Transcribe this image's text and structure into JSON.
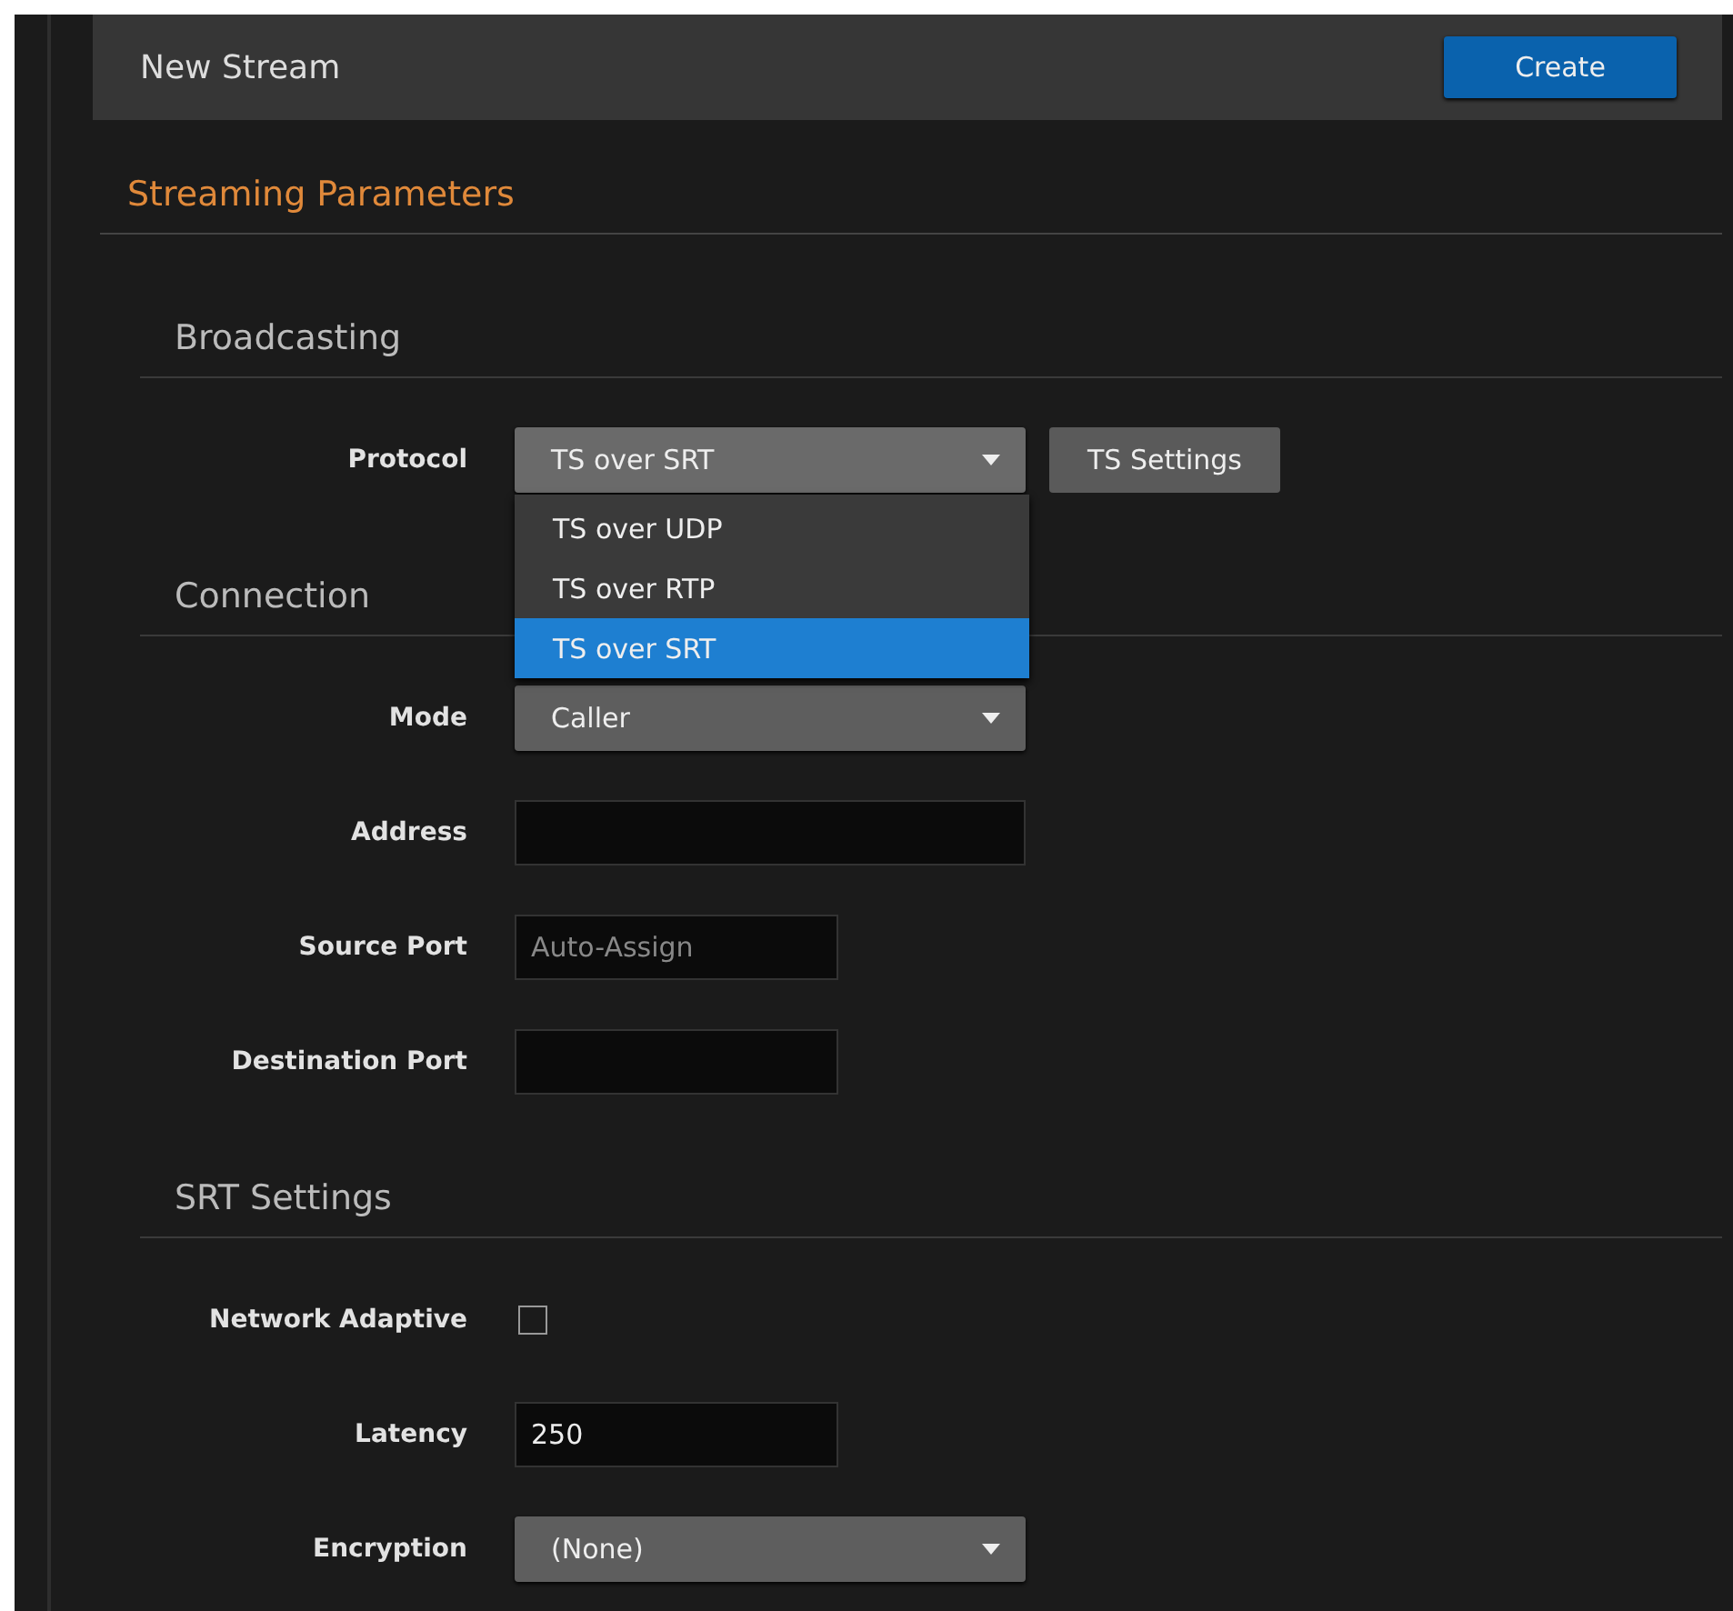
{
  "header": {
    "title": "New Stream",
    "button": "Create"
  },
  "section_title": "Streaming Parameters",
  "groups": [
    {
      "heading": "Broadcasting",
      "fields": [
        {
          "kind": "select",
          "label": "Protocol",
          "value": "TS over SRT",
          "expanded": true,
          "button": "TS Settings",
          "options": [
            {
              "label": "TS over UDP",
              "selected": false
            },
            {
              "label": "TS over RTP",
              "selected": false
            },
            {
              "label": "TS over SRT",
              "selected": true
            }
          ]
        }
      ]
    },
    {
      "heading": "Connection",
      "fields": [
        {
          "kind": "select",
          "label": "Mode",
          "value": "Caller",
          "expanded": false
        },
        {
          "kind": "text",
          "label": "Address"
        },
        {
          "kind": "number",
          "label": "Source Port",
          "placeholder": "Auto-Assign"
        },
        {
          "kind": "number",
          "label": "Destination Port"
        }
      ]
    },
    {
      "heading": "SRT Settings",
      "fields": [
        {
          "kind": "checkbox",
          "label": "Network Adaptive",
          "checked": false
        },
        {
          "kind": "number",
          "label": "Latency",
          "value": "250"
        },
        {
          "kind": "select",
          "label": "Encryption",
          "value": "(None)",
          "expanded": false
        }
      ]
    }
  ]
}
